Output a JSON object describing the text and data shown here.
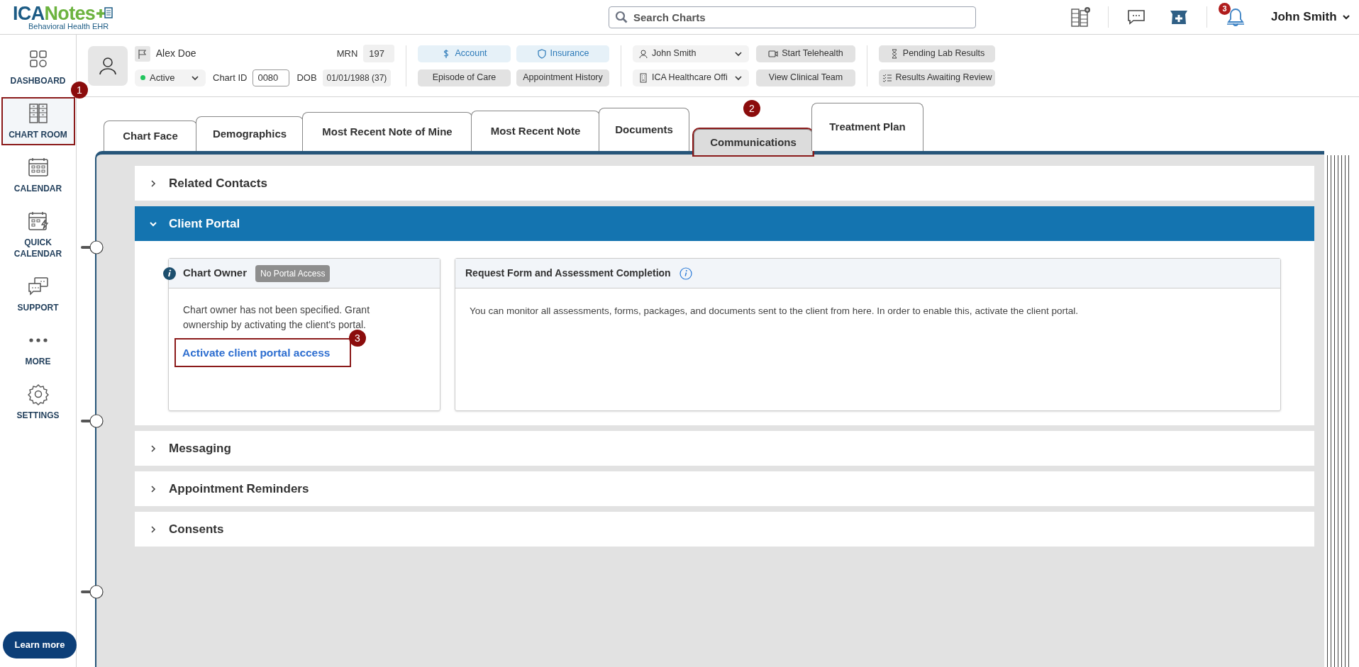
{
  "logo": {
    "primary": "ICA",
    "secondary": "Notes",
    "subtitle": "Behavioral Health EHR"
  },
  "search": {
    "placeholder": "Search Charts"
  },
  "notifications": {
    "count": "3"
  },
  "user": {
    "name": "John Smith"
  },
  "sidebar": {
    "items": [
      {
        "kind": "dashboard",
        "label": "DASHBOARD",
        "selected": false,
        "outlined": false
      },
      {
        "kind": "chartroom",
        "label": "CHART ROOM",
        "selected": true,
        "outlined": true
      },
      {
        "kind": "calendar",
        "label": "CALENDAR",
        "selected": false,
        "outlined": false
      },
      {
        "kind": "quickcalendar",
        "label": "QUICK CALENDAR",
        "selected": false,
        "outlined": false
      },
      {
        "kind": "support",
        "label": "SUPPORT",
        "selected": false,
        "outlined": false
      },
      {
        "kind": "more",
        "label": "MORE",
        "selected": false,
        "outlined": false
      },
      {
        "kind": "settings",
        "label": "SETTINGS",
        "selected": false,
        "outlined": false
      }
    ],
    "learn_more": "Learn more"
  },
  "patient": {
    "name": "Alex Doe",
    "status": "Active",
    "chart_id_label": "Chart ID",
    "chart_id": "0080",
    "mrn_label": "MRN",
    "mrn": "197",
    "dob_label": "DOB",
    "dob": "01/01/1988 (37)"
  },
  "patient_buttons": [
    {
      "kind": "account",
      "label": "Account"
    },
    {
      "kind": "insurance",
      "label": "Insurance"
    },
    {
      "kind": "none",
      "label": "Episode of Care"
    },
    {
      "kind": "none",
      "label": "Appointment History"
    }
  ],
  "provider_select": "John Smith",
  "location_select": "ICA Healthcare Offi",
  "telehealth_buttons": [
    {
      "kind": "video",
      "label": "Start Telehealth"
    },
    {
      "kind": "none",
      "label": "View Clinical Team"
    }
  ],
  "lab_buttons": [
    {
      "kind": "hourglass",
      "label": "Pending Lab Results"
    },
    {
      "kind": "checklist",
      "label": "Results Awaiting Review"
    }
  ],
  "tabs": [
    {
      "label": "Chart Face",
      "selected": false,
      "outlined": false
    },
    {
      "label": "Demographics",
      "selected": false,
      "outlined": false
    },
    {
      "label": "Most Recent Note of Mine",
      "selected": false,
      "outlined": false
    },
    {
      "label": "Most Recent Note",
      "selected": false,
      "outlined": false
    },
    {
      "label": "Documents",
      "selected": false,
      "outlined": false
    },
    {
      "label": "Communications",
      "selected": true,
      "outlined": true
    },
    {
      "label": "Treatment Plan",
      "selected": false,
      "outlined": false
    }
  ],
  "sections": [
    {
      "title": "Related Contacts",
      "expanded": false
    },
    {
      "title": "Client Portal",
      "expanded": true
    },
    {
      "title": "Messaging",
      "expanded": false
    },
    {
      "title": "Appointment Reminders",
      "expanded": false
    },
    {
      "title": "Consents",
      "expanded": false
    }
  ],
  "client_portal": {
    "owner_card": {
      "title": "Chart Owner",
      "badge": "No Portal Access",
      "text": "Chart owner has not been specified. Grant ownership by activating the client's portal.",
      "link": "Activate client portal access",
      "link_outlined": true
    },
    "request_card": {
      "title": "Request Form and Assessment Completion",
      "text": "You can monitor all assessments, forms, packages, and documents sent to the client from here. In order to enable this, activate the client portal."
    }
  },
  "callouts": [
    "1",
    "2",
    "3"
  ]
}
